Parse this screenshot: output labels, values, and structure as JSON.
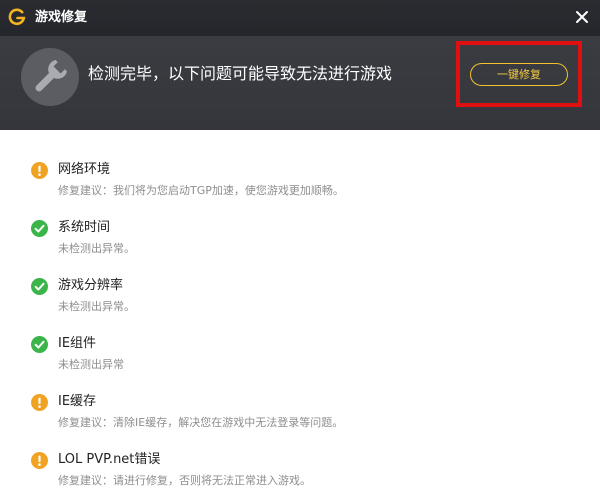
{
  "window": {
    "title": "游戏修复"
  },
  "header": {
    "headline": "检测完毕，以下问题可能导致无法进行游戏",
    "fix_button": "一键修复"
  },
  "colors": {
    "warning": "#f0a323",
    "ok": "#3bb54a",
    "accent": "#f2c12e",
    "highlight_border": "#e01010"
  },
  "items": [
    {
      "status": "warning",
      "icon": "warning-icon",
      "name": "网络环境",
      "detail": "修复建议：我们将为您启动TGP加速，使您游戏更加顺畅。"
    },
    {
      "status": "ok",
      "icon": "check-icon",
      "name": "系统时间",
      "detail": "未检测出异常。"
    },
    {
      "status": "ok",
      "icon": "check-icon",
      "name": "游戏分辨率",
      "detail": "未检测出异常。"
    },
    {
      "status": "ok",
      "icon": "check-icon",
      "name": "IE组件",
      "detail": "未检测出异常"
    },
    {
      "status": "warning",
      "icon": "warning-icon",
      "name": "IE缓存",
      "detail": "修复建议：清除IE缓存，解决您在游戏中无法登录等问题。"
    },
    {
      "status": "warning",
      "icon": "warning-icon",
      "name": "LOL PVP.net错误",
      "detail": "修复建议：请进行修复，否则将无法正常进入游戏。"
    }
  ]
}
